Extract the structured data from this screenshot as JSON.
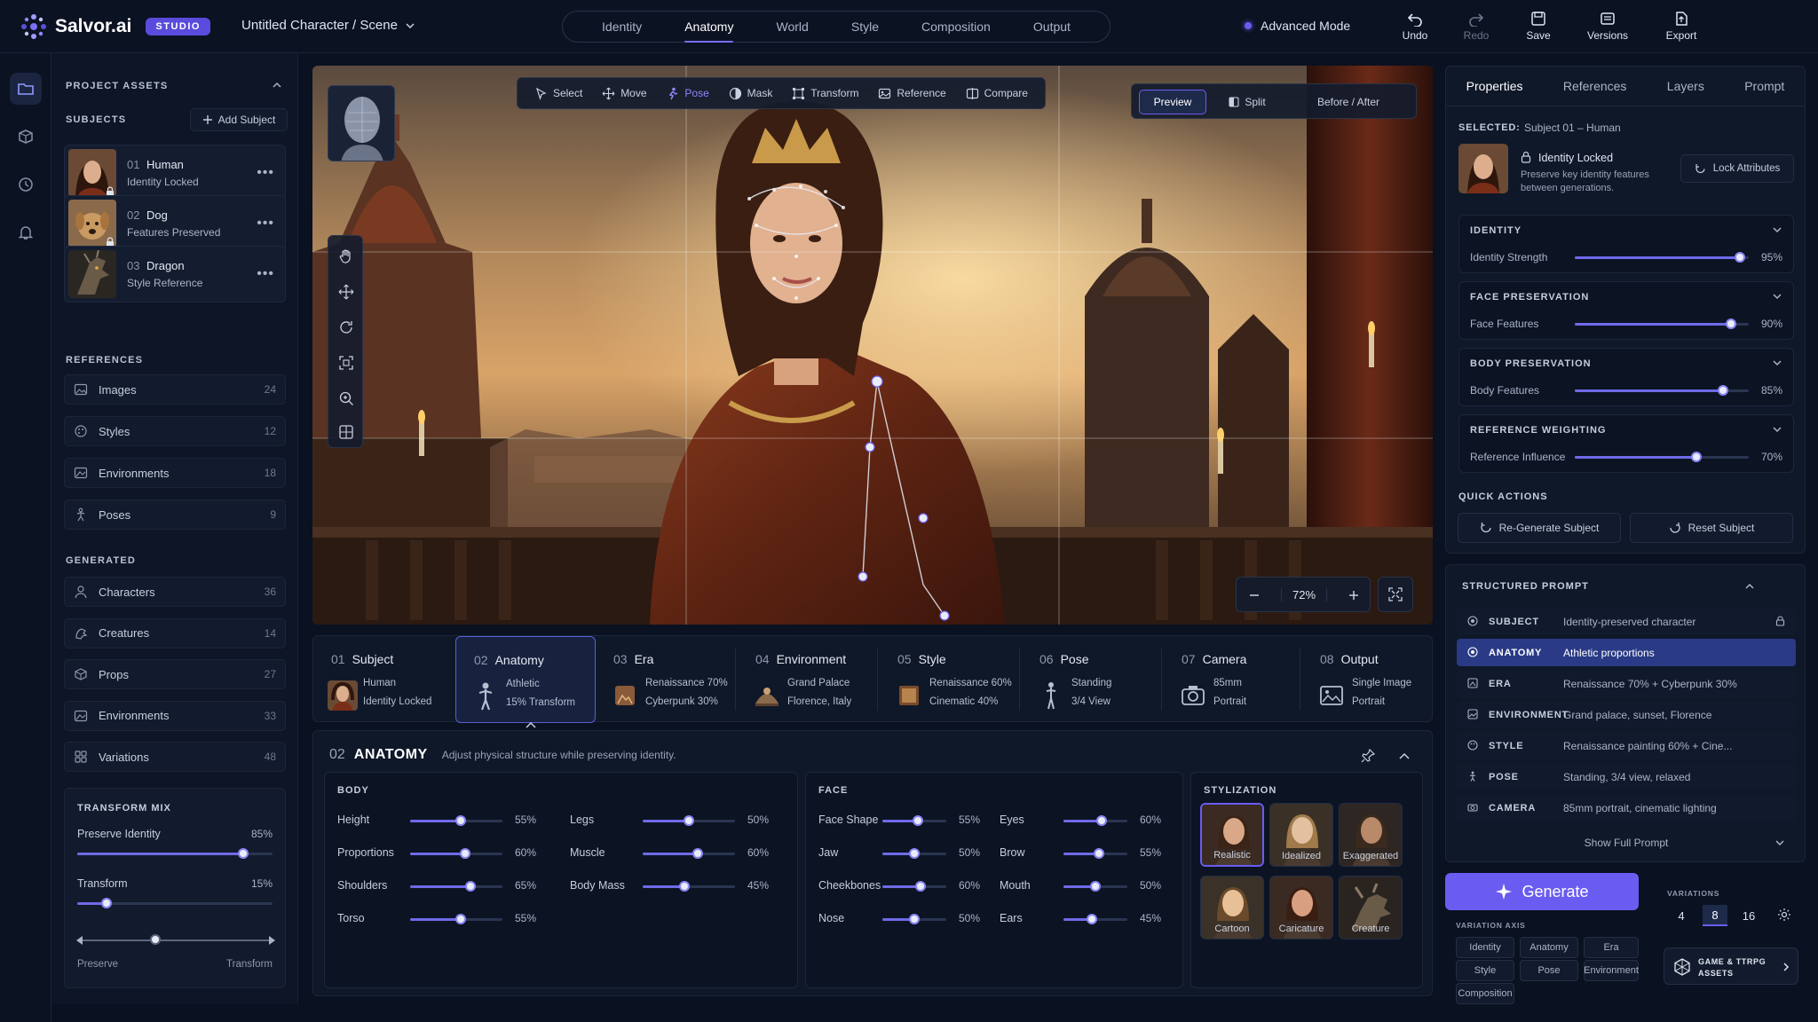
{
  "app": {
    "name": "Salvor.ai",
    "badge": "STUDIO",
    "doc_title": "Untitled Character / Scene"
  },
  "nav_tabs": [
    "Identity",
    "Anatomy",
    "World",
    "Style",
    "Composition",
    "Output"
  ],
  "active_nav": "Anatomy",
  "advanced_mode": "Advanced Mode",
  "top_actions": {
    "undo": "Undo",
    "redo": "Redo",
    "save": "Save",
    "versions": "Versions",
    "export": "Export"
  },
  "left": {
    "project_assets": "PROJECT ASSETS",
    "subjects_title": "SUBJECTS",
    "add_subject": "Add Subject",
    "subjects": [
      {
        "num": "01",
        "name": "Human",
        "status": "Identity Locked"
      },
      {
        "num": "02",
        "name": "Dog",
        "status": "Features Preserved"
      },
      {
        "num": "03",
        "name": "Dragon",
        "status": "Style Reference"
      }
    ],
    "references_title": "REFERENCES",
    "references": [
      {
        "label": "Images",
        "count": "24"
      },
      {
        "label": "Styles",
        "count": "12"
      },
      {
        "label": "Environments",
        "count": "18"
      },
      {
        "label": "Poses",
        "count": "9"
      }
    ],
    "generated_title": "GENERATED",
    "generated": [
      {
        "label": "Characters",
        "count": "36"
      },
      {
        "label": "Creatures",
        "count": "14"
      },
      {
        "label": "Props",
        "count": "27"
      },
      {
        "label": "Environments",
        "count": "33"
      },
      {
        "label": "Variations",
        "count": "48"
      }
    ],
    "transform_mix": {
      "title": "TRANSFORM MIX",
      "preserve_label": "Preserve Identity",
      "preserve_pct": "85%",
      "preserve_value": 85,
      "transform_label": "Transform",
      "transform_pct": "15%",
      "transform_value": 15,
      "balance_value": 40,
      "left_label": "Preserve",
      "right_label": "Transform"
    }
  },
  "canvas": {
    "tools": [
      "Select",
      "Move",
      "Pose",
      "Mask",
      "Transform",
      "Reference",
      "Compare"
    ],
    "active_tool": "Pose",
    "views": [
      "Preview",
      "Split",
      "Before / After"
    ],
    "active_view": "Preview",
    "zoom": "72%"
  },
  "steps": [
    {
      "num": "01",
      "title": "Subject",
      "l1": "Human",
      "l2": "Identity Locked"
    },
    {
      "num": "02",
      "title": "Anatomy",
      "l1": "Athletic",
      "l2": "15% Transform"
    },
    {
      "num": "03",
      "title": "Era",
      "l1": "Renaissance 70%",
      "l2": "Cyberpunk  30%"
    },
    {
      "num": "04",
      "title": "Environment",
      "l1": "Grand Palace",
      "l2": "Florence, Italy"
    },
    {
      "num": "05",
      "title": "Style",
      "l1": "Renaissance 60%",
      "l2": "Cinematic 40%"
    },
    {
      "num": "06",
      "title": "Pose",
      "l1": "Standing",
      "l2": "3/4 View"
    },
    {
      "num": "07",
      "title": "Camera",
      "l1": "85mm",
      "l2": "Portrait"
    },
    {
      "num": "08",
      "title": "Output",
      "l1": "Single Image",
      "l2": "Portrait"
    }
  ],
  "anatomy": {
    "num": "02",
    "title": "ANATOMY",
    "desc": "Adjust physical structure while preserving identity.",
    "body_title": "BODY",
    "body": [
      {
        "label": "Height",
        "pct": "55%",
        "value": 55
      },
      {
        "label": "Legs",
        "pct": "50%",
        "value": 50
      },
      {
        "label": "Proportions",
        "pct": "60%",
        "value": 60
      },
      {
        "label": "Muscle",
        "pct": "60%",
        "value": 60
      },
      {
        "label": "Shoulders",
        "pct": "65%",
        "value": 65
      },
      {
        "label": "Body Mass",
        "pct": "45%",
        "value": 45
      },
      {
        "label": "Torso",
        "pct": "55%",
        "value": 55
      }
    ],
    "face_title": "FACE",
    "face": [
      {
        "label": "Face Shape",
        "pct": "55%",
        "value": 55
      },
      {
        "label": "Eyes",
        "pct": "60%",
        "value": 60
      },
      {
        "label": "Jaw",
        "pct": "50%",
        "value": 50
      },
      {
        "label": "Brow",
        "pct": "55%",
        "value": 55
      },
      {
        "label": "Cheekbones",
        "pct": "60%",
        "value": 60
      },
      {
        "label": "Mouth",
        "pct": "50%",
        "value": 50
      },
      {
        "label": "Nose",
        "pct": "50%",
        "value": 50
      },
      {
        "label": "Ears",
        "pct": "45%",
        "value": 45
      }
    ],
    "stylization_title": "STYLIZATION",
    "stylization": [
      "Realistic",
      "Idealized",
      "Exaggerated",
      "Cartoon",
      "Caricature",
      "Creature"
    ],
    "active_style": "Realistic"
  },
  "right": {
    "tabs": [
      "Properties",
      "References",
      "Layers",
      "Prompt"
    ],
    "active_tab": "Properties",
    "selected_label": "SELECTED:",
    "selected_value": "Subject 01 – Human",
    "identity_locked": "Identity Locked",
    "identity_desc_1": "Preserve key identity features",
    "identity_desc_2": "between generations.",
    "lock_attributes": "Lock Attributes",
    "sections": [
      {
        "title": "IDENTITY",
        "label": "Identity Strength",
        "pct": "95%",
        "value": 95
      },
      {
        "title": "FACE PRESERVATION",
        "label": "Face Features",
        "pct": "90%",
        "value": 90
      },
      {
        "title": "BODY PRESERVATION",
        "label": "Body Features",
        "pct": "85%",
        "value": 85
      },
      {
        "title": "REFERENCE WEIGHTING",
        "label": "Reference Influence",
        "pct": "70%",
        "value": 70
      }
    ],
    "quick_actions": "QUICK ACTIONS",
    "regen": "Re-Generate Subject",
    "reset": "Reset Subject",
    "structured_prompt": "STRUCTURED PROMPT",
    "prompt_rows": [
      {
        "key": "SUBJECT",
        "value": "Identity-preserved character"
      },
      {
        "key": "ANATOMY",
        "value": "Athletic proportions"
      },
      {
        "key": "ERA",
        "value": "Renaissance 70% + Cyberpunk 30%"
      },
      {
        "key": "ENVIRONMENT",
        "value": "Grand palace, sunset, Florence"
      },
      {
        "key": "STYLE",
        "value": "Renaissance painting 60% + Cine..."
      },
      {
        "key": "POSE",
        "value": "Standing, 3/4 view, relaxed"
      },
      {
        "key": "CAMERA",
        "value": "85mm portrait, cinematic lighting"
      }
    ],
    "active_prompt_row": "ANATOMY",
    "show_full": "Show Full Prompt"
  },
  "generate": {
    "label": "Generate",
    "variation_axis": "VARIATION AXIS",
    "axis_chips": [
      "Identity",
      "Anatomy",
      "Era",
      "Style",
      "Pose",
      "Environment",
      "Composition"
    ],
    "variations_title": "VARIATIONS",
    "variation_counts": [
      "4",
      "8",
      "16"
    ],
    "active_variation": "8",
    "ttrpg_1": "GAME & TTRPG",
    "ttrpg_2": "ASSETS"
  },
  "colors": {
    "accent": "#6a5cf0",
    "bg": "#0a1120",
    "panel": "#0f1829"
  }
}
